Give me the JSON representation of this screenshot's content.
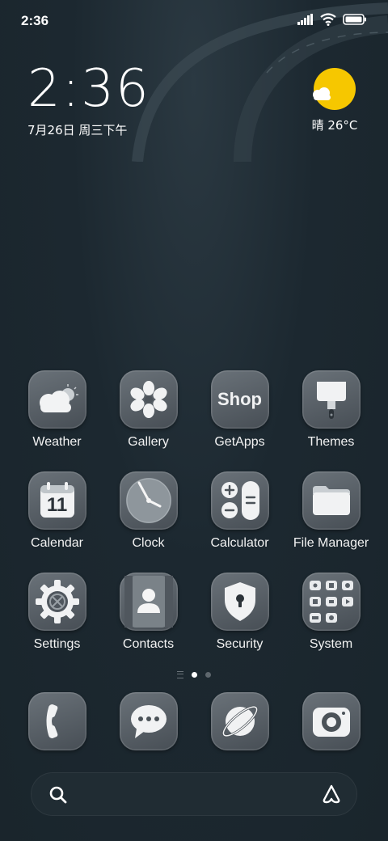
{
  "status_bar": {
    "time": "2:36"
  },
  "clock_widget": {
    "time": "2:36",
    "date": "7月26日 周三下午"
  },
  "weather_widget": {
    "text": "晴 26°C"
  },
  "apps": [
    [
      {
        "label": "Weather"
      },
      {
        "label": "Gallery"
      },
      {
        "label": "GetApps",
        "icon_text": "Shop"
      },
      {
        "label": "Themes"
      }
    ],
    [
      {
        "label": "Calendar",
        "icon_text": "11"
      },
      {
        "label": "Clock"
      },
      {
        "label": "Calculator"
      },
      {
        "label": "File Manager"
      }
    ],
    [
      {
        "label": "Settings"
      },
      {
        "label": "Contacts"
      },
      {
        "label": "Security"
      },
      {
        "label": "System"
      }
    ]
  ],
  "dock": [
    "phone-icon",
    "messages-icon",
    "browser-icon",
    "camera-icon"
  ],
  "pager": {
    "pages": 2,
    "active": 1
  },
  "colors": {
    "background": "#1c2830",
    "icon_tile": "#5a6168",
    "sun": "#f6c700"
  }
}
